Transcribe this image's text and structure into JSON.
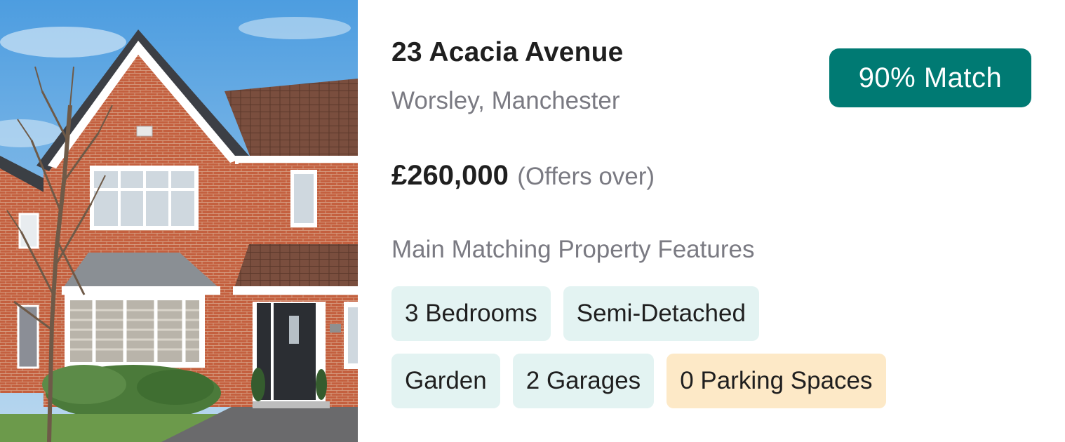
{
  "property": {
    "address": "23 Acacia Avenue",
    "location": "Worsley, Manchester",
    "price": "£260,000",
    "price_qualifier": "(Offers over)",
    "match_label": "90% Match",
    "features_heading": "Main Matching Property Features",
    "features_row1": [
      {
        "label": "3 Bedrooms",
        "status": "match"
      },
      {
        "label": "Semi-Detached",
        "status": "match"
      }
    ],
    "features_row2": [
      {
        "label": "Garden",
        "status": "match"
      },
      {
        "label": "2 Garages",
        "status": "match"
      },
      {
        "label": "0 Parking Spaces",
        "status": "partial"
      }
    ]
  },
  "colors": {
    "match_badge": "#007a73",
    "feature_match_bg": "#e3f3f2",
    "feature_partial_bg": "#fde9c7"
  }
}
